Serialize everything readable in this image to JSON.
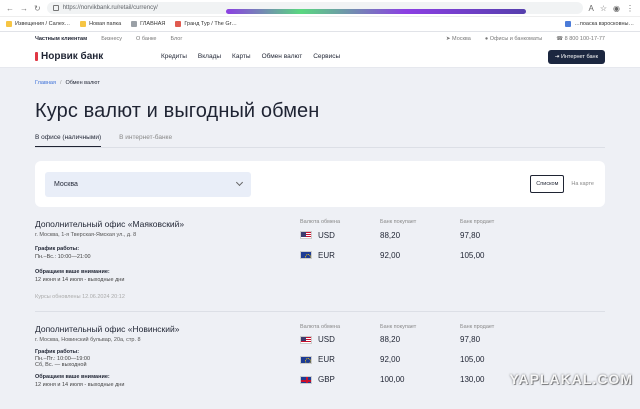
{
  "browser": {
    "url": "https://norvikbank.ru/retail/currency/",
    "bookmarks": [
      {
        "label": "Извещения / Салех…",
        "icon": "folder-icon"
      },
      {
        "label": "Новая папка",
        "icon": "folder-icon"
      },
      {
        "label": "ГЛАВНАЯ",
        "icon": "page-icon"
      },
      {
        "label": "Гранд Тур / The Gr…",
        "icon": "page-icon"
      },
      {
        "label": "…поаска взросковны…",
        "icon": "page-icon"
      }
    ]
  },
  "topbar": {
    "segments": [
      "Частным клиентам",
      "Бизнесу",
      "О банке",
      "Блог"
    ],
    "city": "Москва",
    "offices": "Офисы и банкоматы",
    "phone": "8 800 100-17-77"
  },
  "header": {
    "logo": "Норвик банк",
    "nav": [
      "Кредиты",
      "Вклады",
      "Карты",
      "Обмен валют",
      "Сервисы"
    ],
    "internet_bank": "Интернет банк"
  },
  "breadcrumbs": {
    "home": "Главная",
    "sep": "/",
    "current": "Обмен валют"
  },
  "page_title": "Курс валют и выгодный обмен",
  "tabs": [
    "В офисе (наличными)",
    "В интернет-банке"
  ],
  "filter": {
    "city": "Москва",
    "list_label": "Списком",
    "map_label": "На карте"
  },
  "rate_headers": [
    "Валюта обмена",
    "Банк покупает",
    "Банк продает"
  ],
  "offices": [
    {
      "title": "Дополнительный офис «Маяковский»",
      "address": "г. Москва, 1-я Тверская-Ямская ул., д. 8",
      "schedule_label": "График работы:",
      "schedule": "Пн.–Вс.: 10:00—21:00",
      "notice_label": "Обращаем ваше внимание:",
      "notice": "12 июня и 14 июля - выходные дни",
      "updated": "Курсы обновлены 12.06.2024 20:12",
      "rates": [
        {
          "code": "USD",
          "flag": "us",
          "buy": "88,20",
          "sell": "97,80"
        },
        {
          "code": "EUR",
          "flag": "eu",
          "buy": "92,00",
          "sell": "105,00"
        }
      ]
    },
    {
      "title": "Дополнительный офис «Новинский»",
      "address": "г. Москва, Новинский бульвар, 20а, стр. 8",
      "schedule_label": "График работы:",
      "schedule": "Пн.–Пт.: 10:00—19:00",
      "schedule2": "Сб, Вс. — выходной",
      "notice_label": "Обращаем ваше внимание:",
      "notice": "12 июня и 14 июля - выходные дни",
      "rates": [
        {
          "code": "USD",
          "flag": "us",
          "buy": "88,20",
          "sell": "97,80"
        },
        {
          "code": "EUR",
          "flag": "eu",
          "buy": "92,00",
          "sell": "105,00"
        },
        {
          "code": "GBP",
          "flag": "gb",
          "buy": "100,00",
          "sell": "130,00"
        }
      ]
    }
  ],
  "watermark": "YAPLAKAL.COM"
}
